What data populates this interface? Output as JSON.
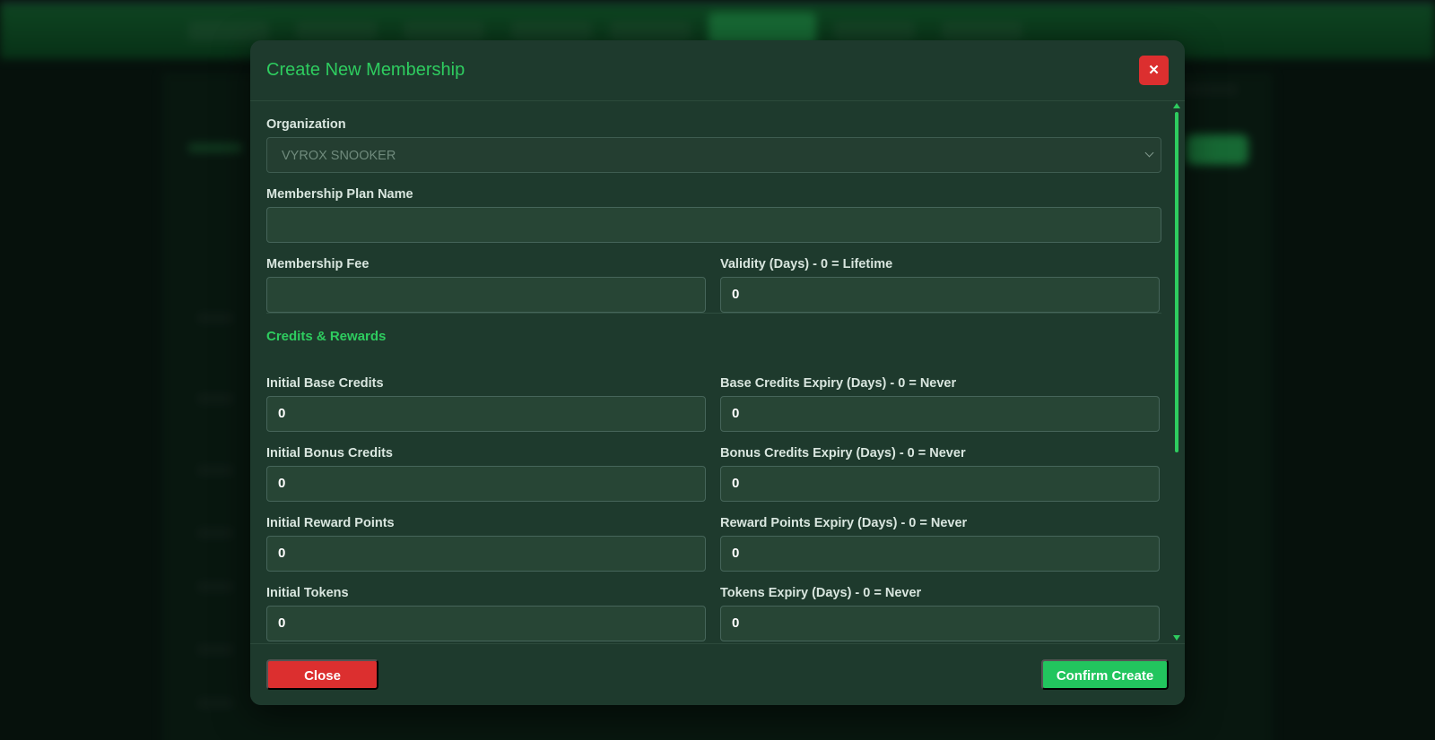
{
  "modal": {
    "title": "Create New Membership",
    "close_icon_glyph": "✕"
  },
  "form": {
    "organization": {
      "label": "Organization",
      "value": "VYROX SNOOKER"
    },
    "plan_name": {
      "label": "Membership Plan Name",
      "value": ""
    },
    "fee": {
      "label": "Membership Fee",
      "value": ""
    },
    "validity": {
      "label": "Validity (Days) - 0 = Lifetime",
      "value": "0"
    },
    "section_title": "Credits & Rewards",
    "base_credits": {
      "label": "Initial Base Credits",
      "value": "0"
    },
    "base_credits_expiry": {
      "label": "Base Credits Expiry (Days) - 0 = Never",
      "value": "0"
    },
    "bonus_credits": {
      "label": "Initial Bonus Credits",
      "value": "0"
    },
    "bonus_credits_expiry": {
      "label": "Bonus Credits Expiry (Days) - 0 = Never",
      "value": "0"
    },
    "reward_points": {
      "label": "Initial Reward Points",
      "value": "0"
    },
    "reward_points_expiry": {
      "label": "Reward Points Expiry (Days) - 0 = Never",
      "value": "0"
    },
    "tokens": {
      "label": "Initial Tokens",
      "value": "0"
    },
    "tokens_expiry": {
      "label": "Tokens Expiry (Days) - 0 = Never",
      "value": "0"
    }
  },
  "footer": {
    "close_label": "Close",
    "confirm_label": "Confirm Create"
  },
  "colors": {
    "accent": "#2ecc5f",
    "danger": "#dc2f2f",
    "confirm": "#22c55e",
    "modal_bg": "#1e3a2d"
  }
}
